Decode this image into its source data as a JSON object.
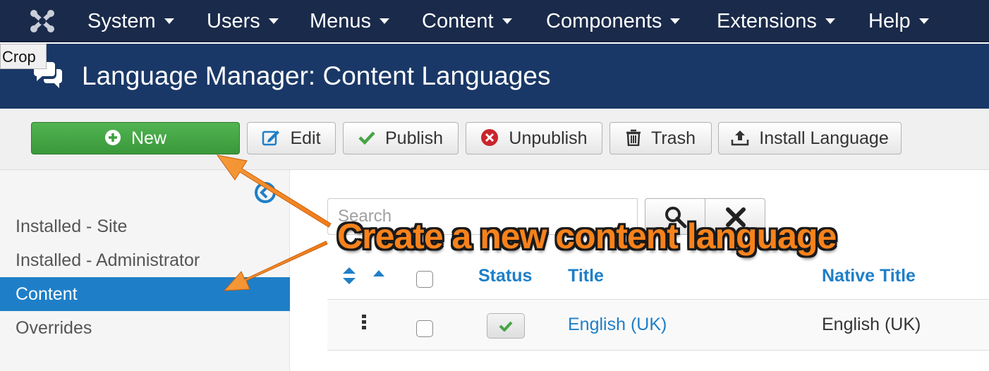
{
  "navbar": {
    "logo_icon": "joomla-logo-icon",
    "menus": [
      "System",
      "Users",
      "Menus",
      "Content",
      "Components",
      "Extensions",
      "Help"
    ]
  },
  "crop_tooltip": "Crop",
  "header": {
    "icon": "comments-icon",
    "title": "Language Manager: Content Languages"
  },
  "toolbar": {
    "new": "New",
    "edit": "Edit",
    "publish": "Publish",
    "unpublish": "Unpublish",
    "trash": "Trash",
    "install_language": "Install Language"
  },
  "sidebar": {
    "toggle_icon": "sidebar-toggle-icon",
    "items": [
      "Installed - Site",
      "Installed - Administrator",
      "Content",
      "Overrides"
    ],
    "active": "Content"
  },
  "search": {
    "placeholder": "Search",
    "value": ""
  },
  "table": {
    "columns": [
      "Status",
      "Title",
      "Native Title"
    ],
    "rows": [
      {
        "published": true,
        "title": "English (UK)",
        "native_title": "English (UK)"
      }
    ]
  },
  "annotation": {
    "text": "Create a new content language"
  },
  "colors": {
    "navbar": "#1a2a4a",
    "header": "#1a3867",
    "new_button": "#46a546",
    "link": "#1e7fc8",
    "callout": "#f7821b"
  }
}
